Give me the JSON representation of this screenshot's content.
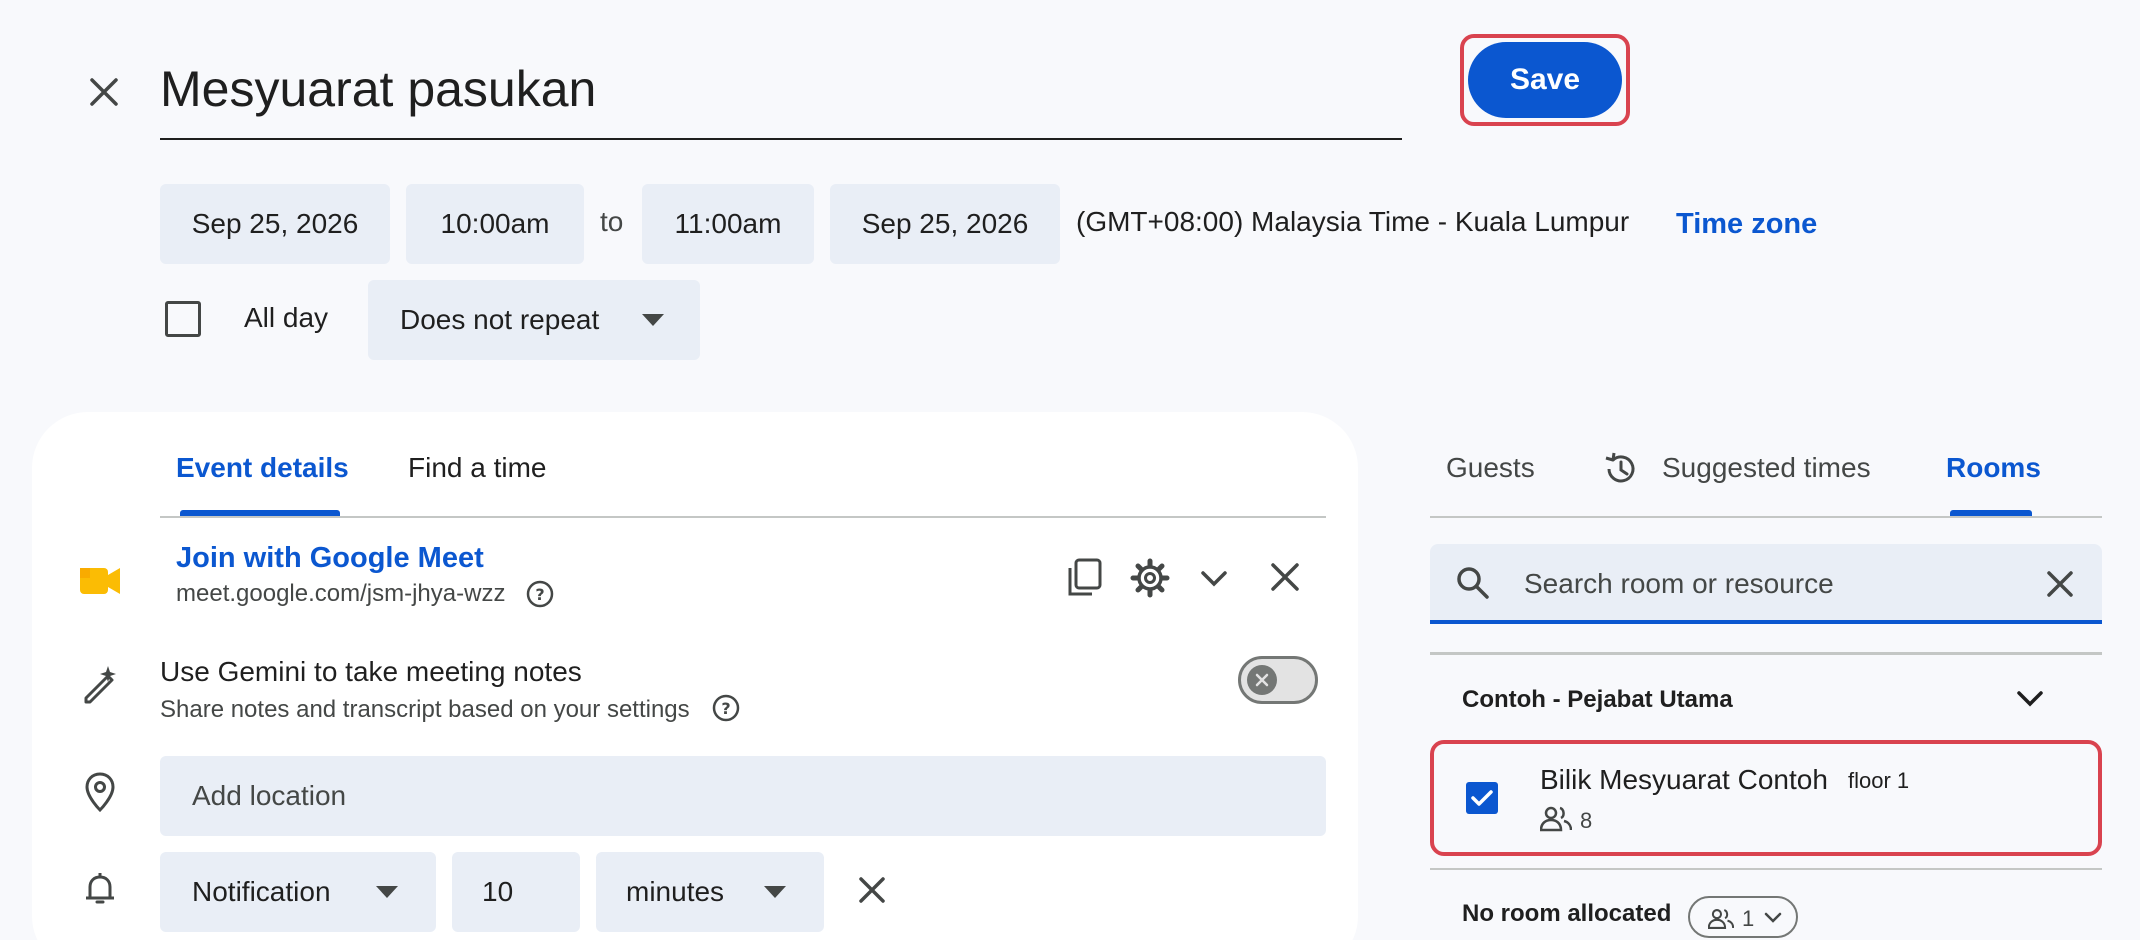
{
  "header": {
    "title": "Mesyuarat pasukan",
    "save_label": "Save"
  },
  "datetime": {
    "start_date": "Sep 25, 2026",
    "start_time": "10:00am",
    "to_label": "to",
    "end_time": "11:00am",
    "end_date": "Sep 25, 2026",
    "timezone_text": "(GMT+08:00) Malaysia Time - Kuala Lumpur",
    "timezone_link": "Time zone"
  },
  "options": {
    "all_day_label": "All day",
    "all_day_checked": false,
    "repeat_value": "Does not repeat"
  },
  "details_tabs": [
    {
      "label": "Event details",
      "active": true
    },
    {
      "label": "Find a time",
      "active": false
    }
  ],
  "meet": {
    "join_label": "Join with Google Meet",
    "link": "meet.google.com/jsm-jhya-wzz"
  },
  "gemini": {
    "title": "Use Gemini to take meeting notes",
    "subtitle": "Share notes and transcript based on your settings",
    "enabled": false
  },
  "location": {
    "placeholder": "Add location"
  },
  "notification": {
    "type": "Notification",
    "amount": "10",
    "unit": "minutes"
  },
  "side_tabs": [
    {
      "label": "Guests",
      "active": false
    },
    {
      "label": "Suggested times",
      "active": false
    },
    {
      "label": "Rooms",
      "active": true
    }
  ],
  "room_search": {
    "placeholder": "Search room or resource"
  },
  "building": {
    "name": "Contoh - Pejabat Utama"
  },
  "rooms": [
    {
      "name": "Bilik Mesyuarat Contoh",
      "floor": "floor 1",
      "capacity": "8",
      "checked": true
    }
  ],
  "no_room": {
    "label": "No room allocated",
    "count": "1"
  },
  "colors": {
    "accent": "#0b57d0",
    "highlight": "#d9434f",
    "chip_bg": "#e9eef6"
  }
}
